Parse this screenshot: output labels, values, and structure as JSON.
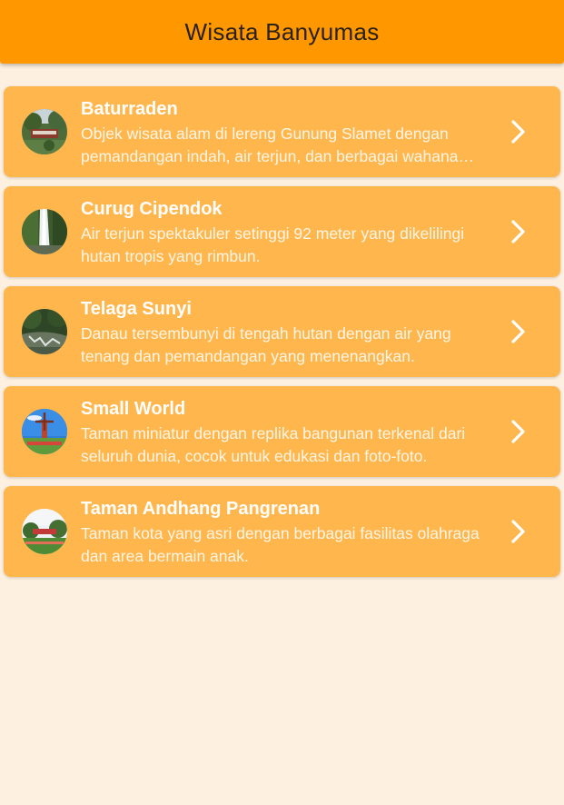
{
  "appbar": {
    "title": "Wisata Banyumas",
    "color": "#ff9800"
  },
  "colors": {
    "background": "#fdf0e0",
    "card": "#ffb74d",
    "text": "#ffffff"
  },
  "items": [
    {
      "title": "Baturraden",
      "description": "Objek wisata alam di lereng Gunung Slamet dengan pemandangan indah, air terjun, dan berbagai wahana rekreasi.",
      "thumbnail": "baturraden-photo",
      "trailing_icon": "chevron-right-icon"
    },
    {
      "title": "Curug Cipendok",
      "description": "Air terjun spektakuler setinggi 92 meter yang dikelilingi hutan tropis yang rimbun.",
      "thumbnail": "curug-cipendok-photo",
      "trailing_icon": "chevron-right-icon"
    },
    {
      "title": "Telaga Sunyi",
      "description": "Danau tersembunyi di tengah hutan dengan air yang tenang dan pemandangan yang menenangkan.",
      "thumbnail": "telaga-sunyi-photo",
      "trailing_icon": "chevron-right-icon"
    },
    {
      "title": "Small World",
      "description": "Taman miniatur dengan replika bangunan terkenal dari seluruh dunia, cocok untuk edukasi dan foto-foto.",
      "thumbnail": "small-world-photo",
      "trailing_icon": "chevron-right-icon"
    },
    {
      "title": "Taman Andhang Pangrenan",
      "description": "Taman kota yang asri dengan berbagai fasilitas olahraga dan area bermain anak.",
      "thumbnail": "taman-andhang-pangrenan-photo",
      "trailing_icon": "chevron-right-icon"
    }
  ]
}
